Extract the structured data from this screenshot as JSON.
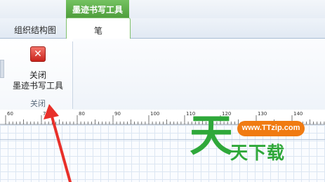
{
  "ribbon": {
    "context_tab_header": "墨迹书写工具",
    "tabs": [
      {
        "label": "组织结构图"
      },
      {
        "label": "笔",
        "active": true
      }
    ],
    "close_group": {
      "button_line1": "关闭",
      "button_line2": "墨迹书写工具",
      "group_label": "关闭"
    }
  },
  "ruler": {
    "labels": [
      "60",
      "70",
      "80",
      "90",
      "100",
      "110",
      "120",
      "130",
      "140"
    ]
  },
  "watermark": {
    "big_char": "天",
    "name": "天下载",
    "url": "www.TTzip.com"
  },
  "colors": {
    "context_tab_green": "#5aad46",
    "close_icon_red": "#d9312a",
    "arrow_red": "#e8302a",
    "watermark_green": "#2fa83a",
    "watermark_orange": "#f07b12"
  }
}
